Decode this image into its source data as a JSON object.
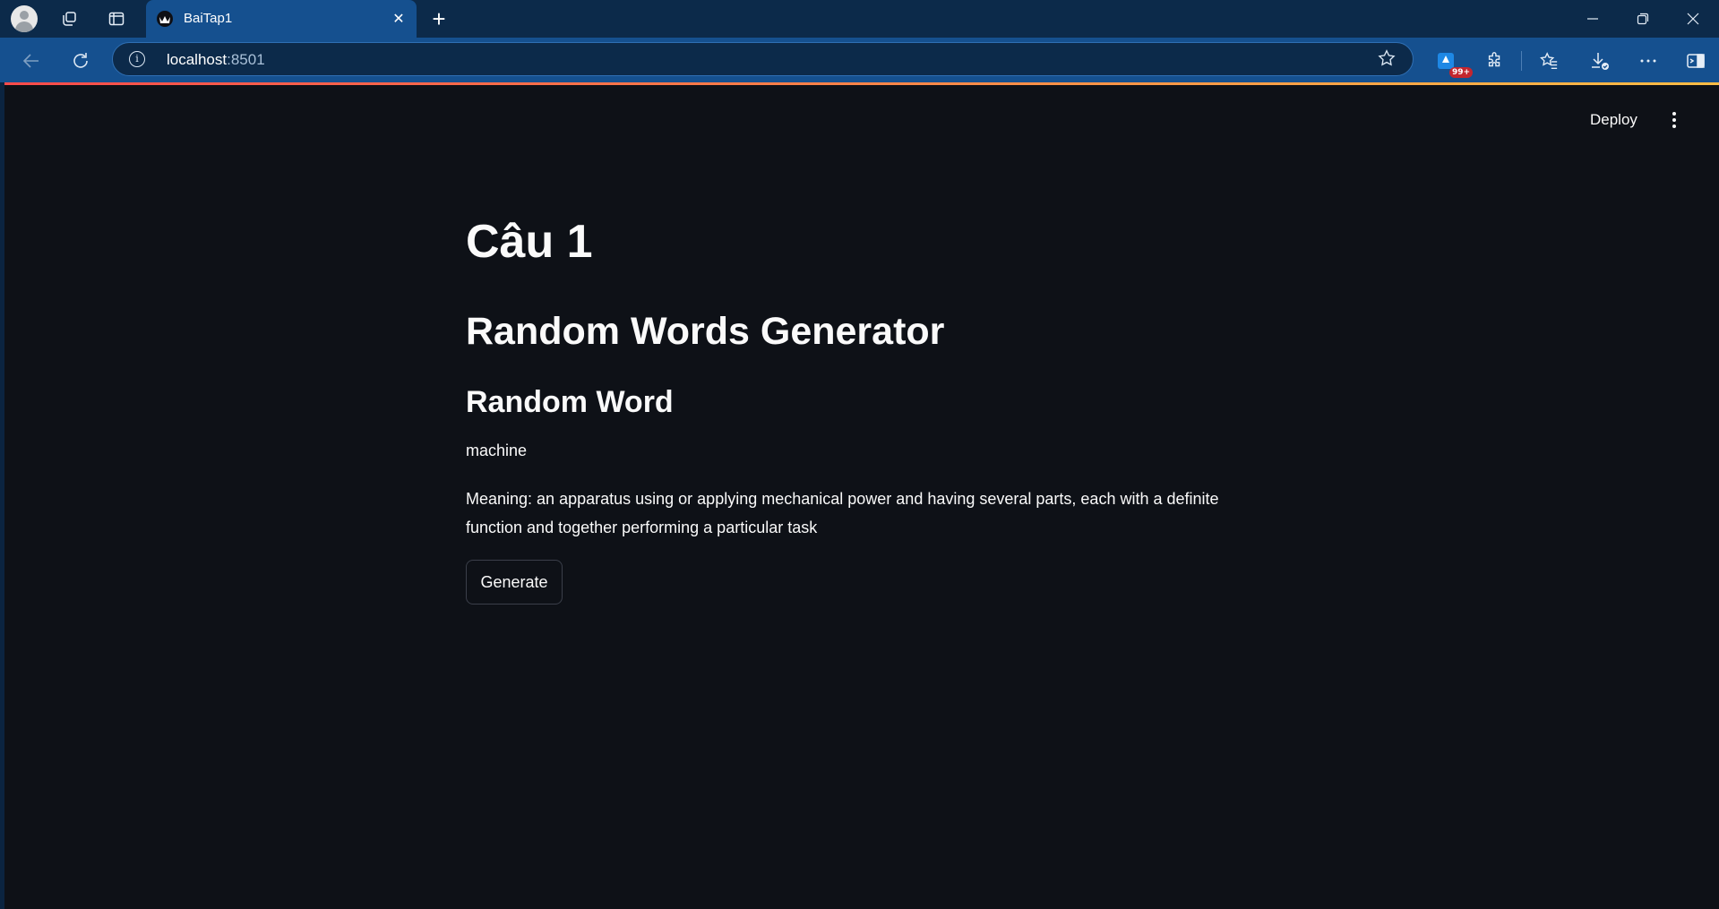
{
  "browser": {
    "tab_title": "BaiTap1",
    "tab_close": "✕",
    "new_tab": "+",
    "url_host": "localhost",
    "url_port": ":8501",
    "extension_badge": "99+",
    "icons": [
      "profile-icon",
      "workspaces-icon",
      "vertical-tabs-icon",
      "back-icon",
      "refresh-icon",
      "info-icon",
      "favorite-star-icon",
      "extension-app-icon",
      "extensions-icon",
      "favorites-icon",
      "downloads-icon",
      "more-icon",
      "sidebar-icon",
      "minimize-icon",
      "restore-icon",
      "close-icon"
    ]
  },
  "app": {
    "deploy_label": "Deploy",
    "title": "Câu 1",
    "header": "Random Words Generator",
    "subheader": "Random Word",
    "word": "machine",
    "meaning": "Meaning: an apparatus using or applying mechanical power and having several parts, each with a definite function and together performing a particular task",
    "generate_label": "Generate"
  },
  "colors": {
    "page_background": "#0e1117",
    "text": "#fafafa",
    "browser_chrome": "#15508f",
    "accent_gradient_start": "#ff4b4b",
    "accent_gradient_end": "#ffbd45"
  }
}
